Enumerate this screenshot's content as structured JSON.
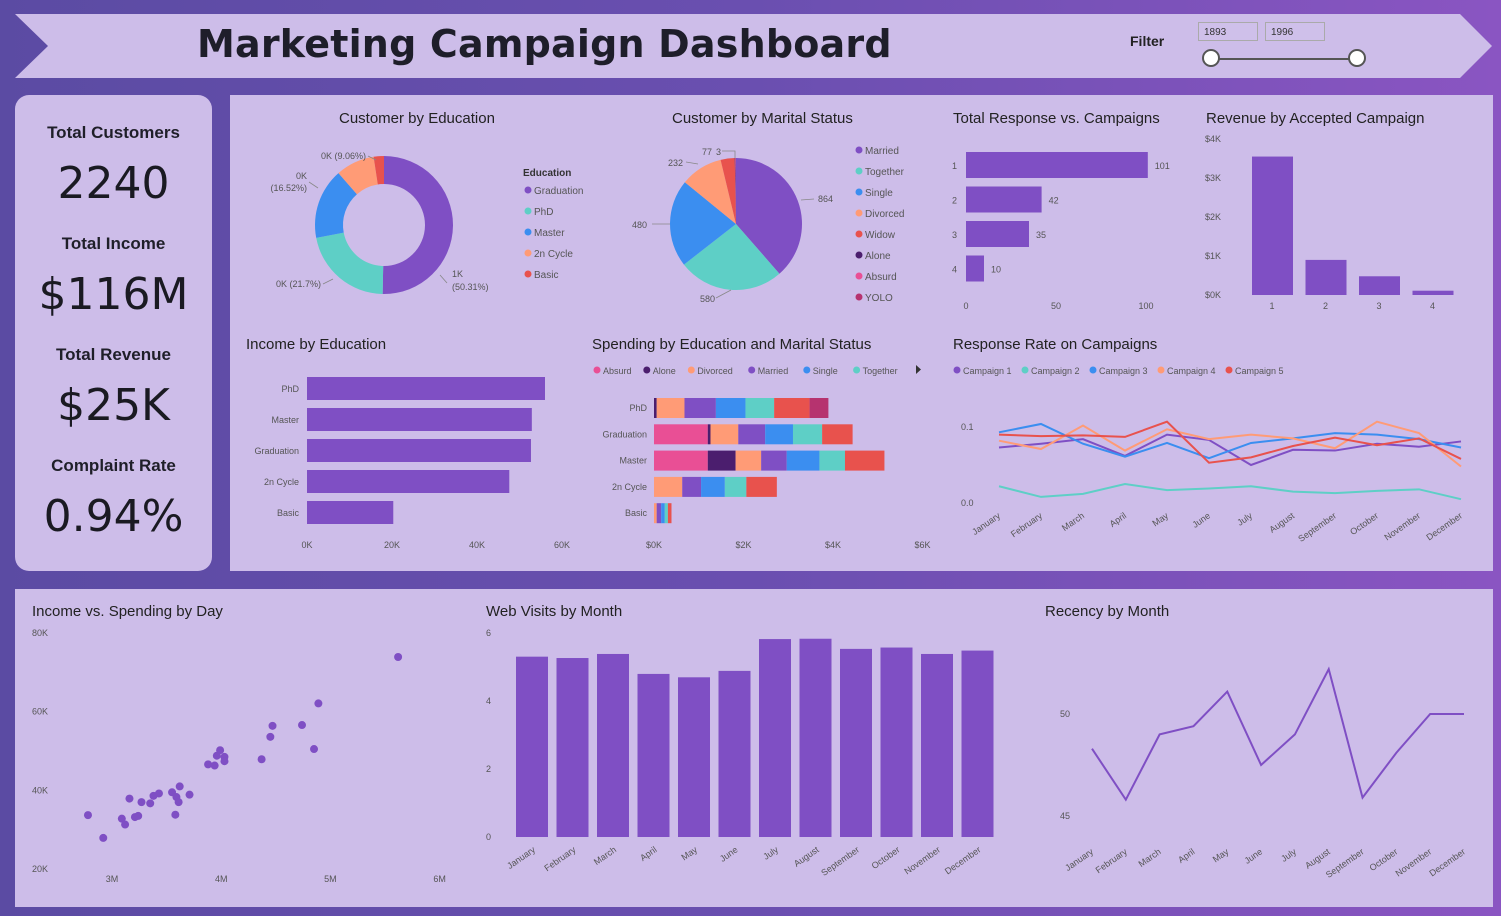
{
  "header": {
    "title": "Marketing Campaign Dashboard",
    "filter_label": "Filter",
    "filter_min": "1893",
    "filter_max": "1996"
  },
  "kpis": {
    "total_customers_label": "Total Customers",
    "total_customers_value": "2240",
    "total_income_label": "Total Income",
    "total_income_value": "$116M",
    "total_revenue_label": "Total Revenue",
    "total_revenue_value": "$25K",
    "complaint_rate_label": "Complaint Rate",
    "complaint_rate_value": "0.94%"
  },
  "colors": {
    "purple": "#7f4fc4",
    "teal": "#5ecfc6",
    "blue": "#3b8ef0",
    "orange": "#ff9b76",
    "red": "#e8524d",
    "dark": "#4b1e6e",
    "pink": "#e94f95",
    "magenta": "#b6336f"
  },
  "chart_data": [
    {
      "type": "pie",
      "id": "edu-donut",
      "title": "Customer by Education",
      "legend_title": "Education",
      "categories": [
        "Graduation",
        "PhD",
        "Master",
        "2n Cycle",
        "Basic"
      ],
      "values": [
        1127,
        486,
        370,
        203,
        54
      ],
      "labels": [
        "1K (50.31%)",
        "0K (21.7%)",
        "0K (16.52%)",
        "0K (9.06%)",
        ""
      ],
      "colors": [
        "#7f4fc4",
        "#5ecfc6",
        "#3b8ef0",
        "#ff9b76",
        "#e8524d"
      ]
    },
    {
      "type": "pie",
      "id": "marital-pie",
      "title": "Customer by Marital Status",
      "categories": [
        "Married",
        "Together",
        "Single",
        "Divorced",
        "Widow",
        "Alone",
        "Absurd",
        "YOLO"
      ],
      "values": [
        864,
        580,
        480,
        232,
        77,
        3,
        2,
        2
      ],
      "labels": [
        "864",
        "580",
        "480",
        "232",
        "77",
        "3",
        "",
        ""
      ],
      "colors": [
        "#7f4fc4",
        "#5ecfc6",
        "#3b8ef0",
        "#ff9b76",
        "#e8524d",
        "#4b1e6e",
        "#e94f95",
        "#b6336f"
      ]
    },
    {
      "type": "bar",
      "id": "response-campaigns",
      "title": "Total Response vs. Campaigns",
      "orientation": "horizontal",
      "categories": [
        "1",
        "2",
        "3",
        "4"
      ],
      "values": [
        101,
        42,
        35,
        10
      ],
      "xticks": [
        "0",
        "50",
        "100"
      ],
      "xlim": [
        0,
        110
      ]
    },
    {
      "type": "bar",
      "id": "revenue-campaign",
      "title": "Revenue by Accepted Campaign",
      "categories": [
        "1",
        "2",
        "3",
        "4"
      ],
      "values": [
        3550,
        900,
        480,
        110
      ],
      "yticks": [
        "$0K",
        "$1K",
        "$2K",
        "$3K",
        "$4K"
      ],
      "ylim": [
        0,
        4000
      ]
    },
    {
      "type": "bar",
      "id": "income-edu",
      "title": "Income by Education",
      "orientation": "horizontal",
      "categories": [
        "PhD",
        "Master",
        "Graduation",
        "2n Cycle",
        "Basic"
      ],
      "values": [
        56000,
        52900,
        52700,
        47600,
        20300
      ],
      "xticks": [
        "0K",
        "20K",
        "40K",
        "60K"
      ],
      "xlim": [
        0,
        60000
      ]
    },
    {
      "type": "bar",
      "id": "spending-edu-marital",
      "title": "Spending by Education and Marital Status",
      "stacked": true,
      "orientation": "horizontal",
      "legend": [
        "Absurd",
        "Alone",
        "Divorced",
        "Married",
        "Single",
        "Together"
      ],
      "categories": [
        "PhD",
        "Graduation",
        "Master",
        "2n Cycle",
        "Basic"
      ],
      "xticks": [
        "$0K",
        "$2K",
        "$4K",
        "$6K"
      ],
      "xlim": [
        0,
        6000
      ],
      "series": [
        {
          "name": "Absurd",
          "color": "#e94f95",
          "values": [
            0,
            1200,
            1200,
            0,
            0
          ]
        },
        {
          "name": "Alone",
          "color": "#4b1e6e",
          "values": [
            60,
            60,
            620,
            0,
            0
          ]
        },
        {
          "name": "Divorced",
          "color": "#ff9b76",
          "values": [
            620,
            620,
            570,
            630,
            60
          ]
        },
        {
          "name": "Married",
          "color": "#7f4fc4",
          "values": [
            700,
            600,
            570,
            420,
            100
          ]
        },
        {
          "name": "Single",
          "color": "#3b8ef0",
          "values": [
            660,
            620,
            730,
            530,
            80
          ]
        },
        {
          "name": "Together",
          "color": "#5ecfc6",
          "values": [
            640,
            650,
            570,
            480,
            70
          ]
        },
        {
          "name": "Widow",
          "color": "#e8524d",
          "values": [
            790,
            680,
            880,
            680,
            80
          ]
        },
        {
          "name": "YOLO",
          "color": "#b6336f",
          "values": [
            420,
            0,
            0,
            0,
            0
          ]
        }
      ]
    },
    {
      "type": "line",
      "id": "response-rate",
      "title": "Response Rate on Campaigns",
      "categories": [
        "January",
        "February",
        "March",
        "April",
        "May",
        "June",
        "July",
        "August",
        "September",
        "October",
        "November",
        "December"
      ],
      "yticks": [
        "0.0",
        "0.1"
      ],
      "ylim": [
        -0.005,
        0.15
      ],
      "series": [
        {
          "name": "Campaign 1",
          "color": "#7f4fc4",
          "values": [
            0.073,
            0.078,
            0.084,
            0.062,
            0.09,
            0.083,
            0.05,
            0.07,
            0.069,
            0.078,
            0.074,
            0.081
          ]
        },
        {
          "name": "Campaign 2",
          "color": "#5ecfc6",
          "values": [
            0.022,
            0.008,
            0.012,
            0.025,
            0.017,
            0.019,
            0.022,
            0.015,
            0.013,
            0.016,
            0.018,
            0.005
          ]
        },
        {
          "name": "Campaign 3",
          "color": "#3b8ef0",
          "values": [
            0.093,
            0.104,
            0.078,
            0.061,
            0.079,
            0.059,
            0.079,
            0.085,
            0.092,
            0.09,
            0.084,
            0.073
          ]
        },
        {
          "name": "Campaign 4",
          "color": "#ff9b76",
          "values": [
            0.082,
            0.071,
            0.102,
            0.069,
            0.097,
            0.084,
            0.09,
            0.085,
            0.072,
            0.107,
            0.092,
            0.048
          ]
        },
        {
          "name": "Campaign 5",
          "color": "#e8524d",
          "values": [
            0.09,
            0.088,
            0.089,
            0.087,
            0.107,
            0.053,
            0.06,
            0.075,
            0.086,
            0.076,
            0.085,
            0.058
          ]
        }
      ]
    },
    {
      "type": "scatter",
      "id": "income-spending",
      "title": "Income vs. Spending by Day",
      "xticks": [
        "3M",
        "4M",
        "5M",
        "6M"
      ],
      "yticks": [
        "20K",
        "40K",
        "60K",
        "80K"
      ],
      "xlim": [
        2.55,
        6.2
      ],
      "ylim": [
        20000,
        80000
      ],
      "points": [
        [
          2.78,
          33700
        ],
        [
          2.92,
          27900
        ],
        [
          3.09,
          32800
        ],
        [
          3.12,
          31300
        ],
        [
          3.16,
          37900
        ],
        [
          3.21,
          33200
        ],
        [
          3.24,
          33500
        ],
        [
          3.27,
          37000
        ],
        [
          3.35,
          36700
        ],
        [
          3.38,
          38600
        ],
        [
          3.43,
          39200
        ],
        [
          3.55,
          39500
        ],
        [
          3.58,
          33800
        ],
        [
          3.59,
          38300
        ],
        [
          3.61,
          37000
        ],
        [
          3.62,
          41000
        ],
        [
          3.71,
          38900
        ],
        [
          3.88,
          46600
        ],
        [
          3.94,
          46300
        ],
        [
          3.96,
          48800
        ],
        [
          3.99,
          50200
        ],
        [
          4.03,
          48500
        ],
        [
          4.03,
          47400
        ],
        [
          4.37,
          47900
        ],
        [
          4.45,
          53600
        ],
        [
          4.47,
          56400
        ],
        [
          4.74,
          56600
        ],
        [
          4.85,
          50500
        ],
        [
          4.89,
          62100
        ],
        [
          5.62,
          73900
        ]
      ]
    },
    {
      "type": "bar",
      "id": "web-visits",
      "title": "Web Visits by Month",
      "categories": [
        "January",
        "February",
        "March",
        "April",
        "May",
        "June",
        "July",
        "August",
        "September",
        "October",
        "November",
        "December"
      ],
      "values": [
        5.33,
        5.29,
        5.41,
        4.82,
        4.72,
        4.91,
        5.85,
        5.86,
        5.56,
        5.6,
        5.41,
        5.51
      ],
      "yticks": [
        "0",
        "2",
        "4",
        "6"
      ],
      "ylim": [
        0,
        6
      ]
    },
    {
      "type": "line",
      "id": "recency",
      "title": "Recency by Month",
      "categories": [
        "January",
        "February",
        "March",
        "April",
        "May",
        "June",
        "July",
        "August",
        "September",
        "October",
        "November",
        "December"
      ],
      "values": [
        48.3,
        45.8,
        49.0,
        49.4,
        51.1,
        47.5,
        49.0,
        52.2,
        45.9,
        48.1,
        50.0,
        50.0
      ],
      "yticks": [
        "45",
        "50"
      ],
      "ylim": [
        43,
        54
      ]
    }
  ]
}
